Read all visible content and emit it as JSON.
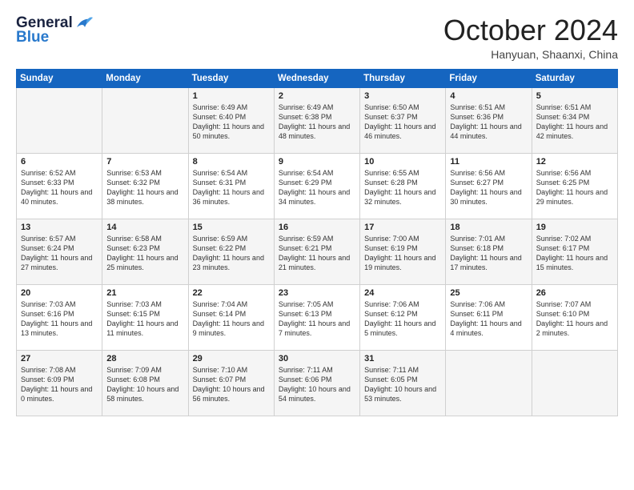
{
  "logo": {
    "line1": "General",
    "line2": "Blue"
  },
  "title": "October 2024",
  "location": "Hanyuan, Shaanxi, China",
  "weekdays": [
    "Sunday",
    "Monday",
    "Tuesday",
    "Wednesday",
    "Thursday",
    "Friday",
    "Saturday"
  ],
  "weeks": [
    [
      {
        "day": "",
        "sunrise": "",
        "sunset": "",
        "daylight": ""
      },
      {
        "day": "",
        "sunrise": "",
        "sunset": "",
        "daylight": ""
      },
      {
        "day": "1",
        "sunrise": "Sunrise: 6:49 AM",
        "sunset": "Sunset: 6:40 PM",
        "daylight": "Daylight: 11 hours and 50 minutes."
      },
      {
        "day": "2",
        "sunrise": "Sunrise: 6:49 AM",
        "sunset": "Sunset: 6:38 PM",
        "daylight": "Daylight: 11 hours and 48 minutes."
      },
      {
        "day": "3",
        "sunrise": "Sunrise: 6:50 AM",
        "sunset": "Sunset: 6:37 PM",
        "daylight": "Daylight: 11 hours and 46 minutes."
      },
      {
        "day": "4",
        "sunrise": "Sunrise: 6:51 AM",
        "sunset": "Sunset: 6:36 PM",
        "daylight": "Daylight: 11 hours and 44 minutes."
      },
      {
        "day": "5",
        "sunrise": "Sunrise: 6:51 AM",
        "sunset": "Sunset: 6:34 PM",
        "daylight": "Daylight: 11 hours and 42 minutes."
      }
    ],
    [
      {
        "day": "6",
        "sunrise": "Sunrise: 6:52 AM",
        "sunset": "Sunset: 6:33 PM",
        "daylight": "Daylight: 11 hours and 40 minutes."
      },
      {
        "day": "7",
        "sunrise": "Sunrise: 6:53 AM",
        "sunset": "Sunset: 6:32 PM",
        "daylight": "Daylight: 11 hours and 38 minutes."
      },
      {
        "day": "8",
        "sunrise": "Sunrise: 6:54 AM",
        "sunset": "Sunset: 6:31 PM",
        "daylight": "Daylight: 11 hours and 36 minutes."
      },
      {
        "day": "9",
        "sunrise": "Sunrise: 6:54 AM",
        "sunset": "Sunset: 6:29 PM",
        "daylight": "Daylight: 11 hours and 34 minutes."
      },
      {
        "day": "10",
        "sunrise": "Sunrise: 6:55 AM",
        "sunset": "Sunset: 6:28 PM",
        "daylight": "Daylight: 11 hours and 32 minutes."
      },
      {
        "day": "11",
        "sunrise": "Sunrise: 6:56 AM",
        "sunset": "Sunset: 6:27 PM",
        "daylight": "Daylight: 11 hours and 30 minutes."
      },
      {
        "day": "12",
        "sunrise": "Sunrise: 6:56 AM",
        "sunset": "Sunset: 6:25 PM",
        "daylight": "Daylight: 11 hours and 29 minutes."
      }
    ],
    [
      {
        "day": "13",
        "sunrise": "Sunrise: 6:57 AM",
        "sunset": "Sunset: 6:24 PM",
        "daylight": "Daylight: 11 hours and 27 minutes."
      },
      {
        "day": "14",
        "sunrise": "Sunrise: 6:58 AM",
        "sunset": "Sunset: 6:23 PM",
        "daylight": "Daylight: 11 hours and 25 minutes."
      },
      {
        "day": "15",
        "sunrise": "Sunrise: 6:59 AM",
        "sunset": "Sunset: 6:22 PM",
        "daylight": "Daylight: 11 hours and 23 minutes."
      },
      {
        "day": "16",
        "sunrise": "Sunrise: 6:59 AM",
        "sunset": "Sunset: 6:21 PM",
        "daylight": "Daylight: 11 hours and 21 minutes."
      },
      {
        "day": "17",
        "sunrise": "Sunrise: 7:00 AM",
        "sunset": "Sunset: 6:19 PM",
        "daylight": "Daylight: 11 hours and 19 minutes."
      },
      {
        "day": "18",
        "sunrise": "Sunrise: 7:01 AM",
        "sunset": "Sunset: 6:18 PM",
        "daylight": "Daylight: 11 hours and 17 minutes."
      },
      {
        "day": "19",
        "sunrise": "Sunrise: 7:02 AM",
        "sunset": "Sunset: 6:17 PM",
        "daylight": "Daylight: 11 hours and 15 minutes."
      }
    ],
    [
      {
        "day": "20",
        "sunrise": "Sunrise: 7:03 AM",
        "sunset": "Sunset: 6:16 PM",
        "daylight": "Daylight: 11 hours and 13 minutes."
      },
      {
        "day": "21",
        "sunrise": "Sunrise: 7:03 AM",
        "sunset": "Sunset: 6:15 PM",
        "daylight": "Daylight: 11 hours and 11 minutes."
      },
      {
        "day": "22",
        "sunrise": "Sunrise: 7:04 AM",
        "sunset": "Sunset: 6:14 PM",
        "daylight": "Daylight: 11 hours and 9 minutes."
      },
      {
        "day": "23",
        "sunrise": "Sunrise: 7:05 AM",
        "sunset": "Sunset: 6:13 PM",
        "daylight": "Daylight: 11 hours and 7 minutes."
      },
      {
        "day": "24",
        "sunrise": "Sunrise: 7:06 AM",
        "sunset": "Sunset: 6:12 PM",
        "daylight": "Daylight: 11 hours and 5 minutes."
      },
      {
        "day": "25",
        "sunrise": "Sunrise: 7:06 AM",
        "sunset": "Sunset: 6:11 PM",
        "daylight": "Daylight: 11 hours and 4 minutes."
      },
      {
        "day": "26",
        "sunrise": "Sunrise: 7:07 AM",
        "sunset": "Sunset: 6:10 PM",
        "daylight": "Daylight: 11 hours and 2 minutes."
      }
    ],
    [
      {
        "day": "27",
        "sunrise": "Sunrise: 7:08 AM",
        "sunset": "Sunset: 6:09 PM",
        "daylight": "Daylight: 11 hours and 0 minutes."
      },
      {
        "day": "28",
        "sunrise": "Sunrise: 7:09 AM",
        "sunset": "Sunset: 6:08 PM",
        "daylight": "Daylight: 10 hours and 58 minutes."
      },
      {
        "day": "29",
        "sunrise": "Sunrise: 7:10 AM",
        "sunset": "Sunset: 6:07 PM",
        "daylight": "Daylight: 10 hours and 56 minutes."
      },
      {
        "day": "30",
        "sunrise": "Sunrise: 7:11 AM",
        "sunset": "Sunset: 6:06 PM",
        "daylight": "Daylight: 10 hours and 54 minutes."
      },
      {
        "day": "31",
        "sunrise": "Sunrise: 7:11 AM",
        "sunset": "Sunset: 6:05 PM",
        "daylight": "Daylight: 10 hours and 53 minutes."
      },
      {
        "day": "",
        "sunrise": "",
        "sunset": "",
        "daylight": ""
      },
      {
        "day": "",
        "sunrise": "",
        "sunset": "",
        "daylight": ""
      }
    ]
  ]
}
